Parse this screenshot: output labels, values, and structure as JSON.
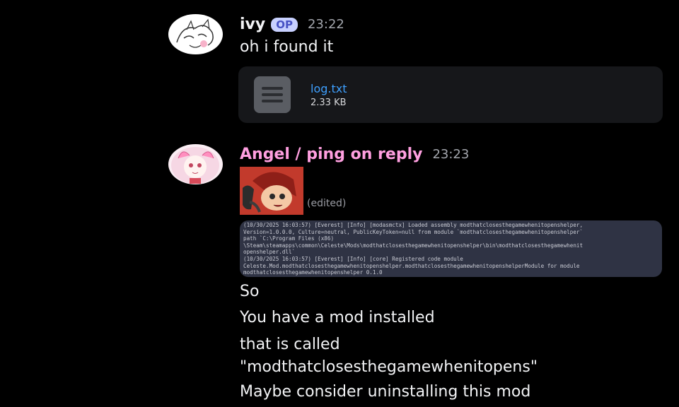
{
  "messages": [
    {
      "author": "ivy",
      "badge": "OP",
      "time": "23:22",
      "text": "oh i found it",
      "attachment": {
        "name": "log.txt",
        "size": "2.33 KB",
        "icon": "file-text-icon"
      }
    },
    {
      "author": "Angel / ping on reply",
      "time": "23:23",
      "sticker_edited": "(edited)",
      "log_lines": [
        "(10/30/2025 16:03:57) [Everest] [Info] [modasmctx] Loaded assembly modthatclosesthegamewhenitopenshelper,",
        "Version=1.0.0.0, Culture=neutral, PublicKeyToken=null from module `modthatclosesthegamewhenitopenshelper`",
        "path `C:\\Program Files (x86)",
        "\\Steam\\steamapps\\common\\Celeste\\Mods\\modthatclosesthegamewhenitopenshelper\\bin\\modthatclosesthegamewhenit",
        "openshelper.dll`",
        "(10/30/2025 16:03:57) [Everest] [Info] [core] Registered code module",
        "Celeste.Mod.modthatclosesthegamewhenitopenshelper.modthatclosesthegamewhenitopenshelperModule for module",
        "modthatclosesthegamewhenitopenshelper 0.1.0"
      ],
      "lines": [
        "So",
        "You have a mod installed",
        "that is called",
        "\"modthatclosesthegamewhenitopens\"",
        "Maybe consider uninstalling this mod"
      ]
    }
  ],
  "colors": {
    "background": "#000000",
    "link": "#3ea0ff",
    "author2": "#ff9fe0",
    "op_badge": "#c7d0ff"
  }
}
